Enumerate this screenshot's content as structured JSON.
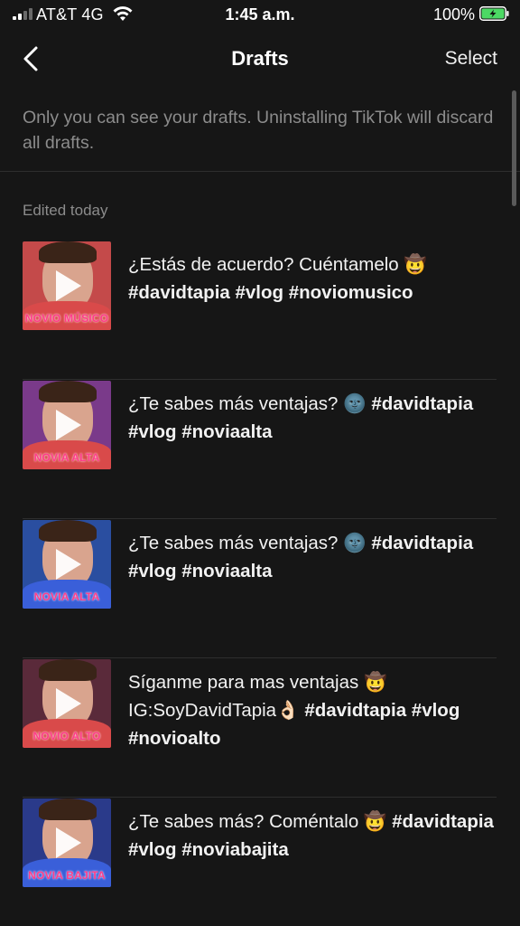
{
  "status_bar": {
    "carrier": "AT&T 4G",
    "time": "1:45 a.m.",
    "battery_percent": "100%"
  },
  "nav": {
    "title": "Drafts",
    "select_label": "Select"
  },
  "notice": "Only you can see your drafts. Uninstalling TikTok will discard all drafts.",
  "section_label": "Edited today",
  "drafts": [
    {
      "text": "¿Estás de acuerdo? Cuéntamelo 🤠",
      "hashtags": "#davidtapia #vlog #noviomusico",
      "thumb_caption": "NOVIO MÚSICO",
      "thumb_bg": "#c44a4a",
      "shirt_color": "#d94a4a"
    },
    {
      "text": "¿Te sabes más ventajas? 🌚",
      "hashtags": "#davidtapia #vlog #noviaalta",
      "thumb_caption": "NOVIA ALTA",
      "thumb_bg": "#7a3a8a",
      "shirt_color": "#d94a4a"
    },
    {
      "text": "¿Te sabes más ventajas? 🌚",
      "hashtags": "#davidtapia #vlog #noviaalta",
      "thumb_caption": "NOVIA ALTA",
      "thumb_bg": "#2a4ea0",
      "shirt_color": "#3a5fd9"
    },
    {
      "text": "Síganme para mas ventajas 🤠 IG:SoyDavidTapia👌🏻",
      "hashtags": "#davidtapia #vlog #novioalto",
      "thumb_caption": "NOVIO ALTO",
      "thumb_bg": "#5a2a3a",
      "shirt_color": "#d94a4a"
    },
    {
      "text": "¿Te sabes más? Coméntalo 🤠",
      "hashtags": "#davidtapia #vlog #noviabajita",
      "thumb_caption": "NOVIA BAJITA",
      "thumb_bg": "#2a3a8a",
      "shirt_color": "#3a5fd9"
    }
  ],
  "colors": {
    "background": "#161616",
    "secondary_text": "#8c8c8c",
    "divider": "#2e2e2e",
    "battery_green": "#4cd964"
  },
  "icons": [
    "signal-icon",
    "wifi-icon",
    "battery-icon",
    "back-chevron-icon",
    "play-icon"
  ]
}
